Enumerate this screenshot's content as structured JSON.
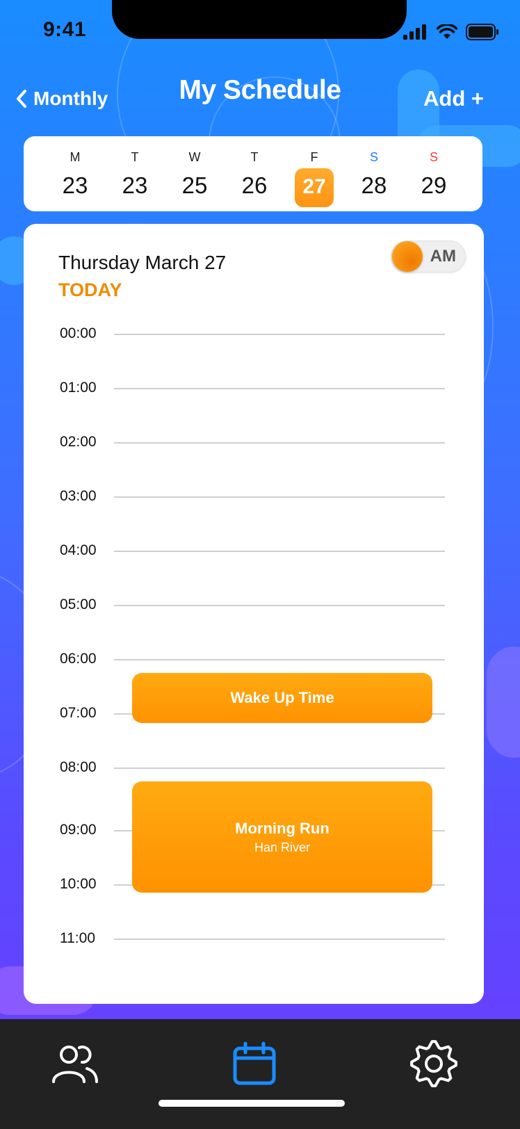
{
  "status_bar": {
    "time": "9:41"
  },
  "nav": {
    "back_label": "Monthly",
    "title": "My Schedule",
    "add_label": "Add +"
  },
  "week": {
    "days": [
      {
        "letter": "M",
        "number": "23",
        "letter_color": "#222222"
      },
      {
        "letter": "T",
        "number": "23",
        "letter_color": "#222222"
      },
      {
        "letter": "W",
        "number": "25",
        "letter_color": "#222222"
      },
      {
        "letter": "T",
        "number": "26",
        "letter_color": "#222222"
      },
      {
        "letter": "F",
        "number": "27",
        "letter_color": "#222222",
        "selected": true
      },
      {
        "letter": "S",
        "number": "28",
        "letter_color": "#1a7fff"
      },
      {
        "letter": "S",
        "number": "29",
        "letter_color": "#ff3b30"
      }
    ]
  },
  "day_view": {
    "date_title": "Thursday March 27",
    "today_label": "TODAY",
    "period_toggle": "AM",
    "hours": [
      "00:00",
      "01:00",
      "02:00",
      "03:00",
      "04:00",
      "05:00",
      "06:00",
      "07:00",
      "08:00",
      "09:00",
      "10:00",
      "11:00"
    ],
    "events": [
      {
        "title": "Wake Up Time",
        "subtitle": ""
      },
      {
        "title": "Morning Run",
        "subtitle": "Han River"
      }
    ]
  },
  "tab_bar": {
    "tabs": [
      {
        "icon": "people-icon",
        "active": false
      },
      {
        "icon": "calendar-icon",
        "active": true
      },
      {
        "icon": "gear-icon",
        "active": false
      }
    ]
  },
  "colors": {
    "accent_orange": "#ff9a0a",
    "active_tab": "#1a8cff",
    "today": "#ef8b00"
  }
}
